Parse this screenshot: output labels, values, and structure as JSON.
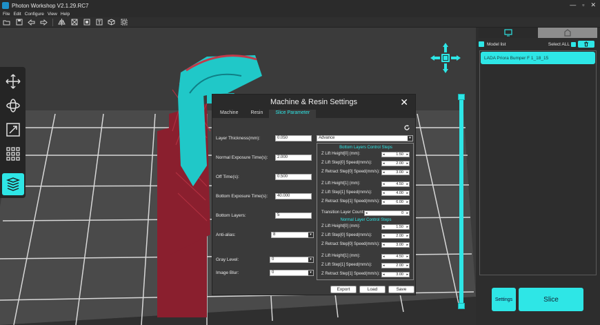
{
  "window": {
    "title": "Photon Workshop V2.1.29.RC7"
  },
  "menu": [
    "File",
    "Edit",
    "Configure",
    "View",
    "Help"
  ],
  "toolbar_icons": [
    "open-icon",
    "save-icon",
    "undo-icon",
    "redo-icon",
    "mirror-icon",
    "fit-icon",
    "solid-view-icon",
    "text-icon",
    "box-icon",
    "frame-icon"
  ],
  "left_tools": [
    "move-icon",
    "rotate-icon",
    "scale-icon",
    "grid-icon",
    "layers-icon"
  ],
  "sidepanel": {
    "model_list_label": "Model list",
    "select_all_label": "Select ALL",
    "models": [
      "LADA Priora Bumper F 1_18_15"
    ],
    "settings_label": "Settings",
    "slice_label": "Slice"
  },
  "dialog": {
    "title": "Machine & Resin Settings",
    "close_label": "✕",
    "tabs": [
      "Machine",
      "Resin",
      "Slice Parameter"
    ],
    "active_tab": "Slice Parameter",
    "fields": {
      "layer_thickness": {
        "label": "Layer Thickness(mm):",
        "value": "0.050"
      },
      "mode": {
        "value": "Advance"
      },
      "normal_exposure": {
        "label": "Normal Exposure Time(s):",
        "value": "2.000"
      },
      "off_time": {
        "label": "Off Time(s):",
        "value": "0.500"
      },
      "bottom_exposure": {
        "label": "Bottom Exposure Time(s):",
        "value": "40.000"
      },
      "bottom_layers": {
        "label": "Bottom Layers:",
        "value": "5"
      },
      "anti_alias": {
        "label": "Anti-alias:",
        "value": "8"
      },
      "gray_level": {
        "label": "Gray Level:",
        "value": "0"
      },
      "image_blur": {
        "label": "Image Blur:",
        "value": "0"
      }
    },
    "bottom_section": {
      "title": "Bottom Layers Control Steps",
      "rows": [
        {
          "label": "Z Lift Height[0] (mm):",
          "value": "1.50"
        },
        {
          "label": "Z Lift Step[0] Speed(mm/s):",
          "value": "2.00"
        },
        {
          "label": "Z Retract Step[0] Speed(mm/s):",
          "value": "3.00"
        },
        {
          "label": "Z Lift Height[1] (mm):",
          "value": "4.50"
        },
        {
          "label": "Z Lift Step[1] Speed(mm/s):",
          "value": "4.00"
        },
        {
          "label": "Z Retract Step[1] Speed(mm/s):",
          "value": "6.00"
        }
      ]
    },
    "transition": {
      "label": "Transition Layer Count:",
      "value": "0"
    },
    "normal_section": {
      "title": "Normal Layer Control Steps",
      "rows": [
        {
          "label": "Z Lift Height[0] (mm):",
          "value": "1.50"
        },
        {
          "label": "Z Lift Step[0] Speed(mm/s):",
          "value": "2.00"
        },
        {
          "label": "Z Retract Step[0] Speed(mm/s):",
          "value": "3.00"
        },
        {
          "label": "Z Lift Height[1] (mm):",
          "value": "4.50"
        },
        {
          "label": "Z Lift Step[1] Speed(mm/s):",
          "value": "2.00"
        },
        {
          "label": "Z Retract Step[1] Speed(mm/s):",
          "value": "3.00"
        }
      ]
    },
    "buttons": {
      "export": "Export",
      "load": "Load",
      "save": "Save"
    }
  },
  "colors": {
    "accent": "#2ee6e6",
    "model_body": "#20c8c8",
    "supports": "#8a1f2e"
  }
}
